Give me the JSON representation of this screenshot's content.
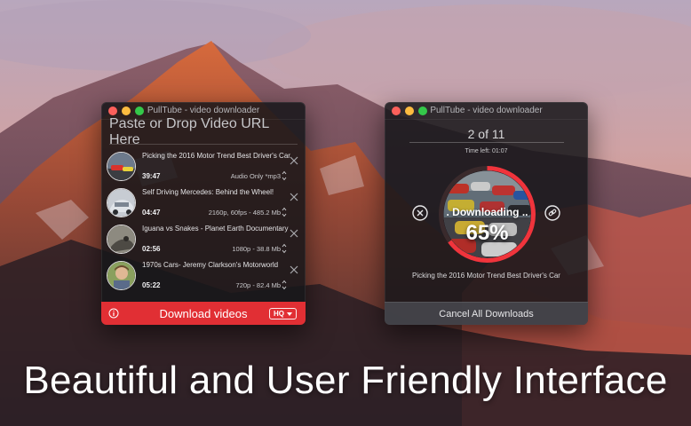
{
  "left_window": {
    "title": "PullTube - video downloader",
    "url_placeholder": "Paste or Drop Video URL Here",
    "items": [
      {
        "title": "Picking the 2016 Motor Trend Best Driver's Car",
        "duration": "39:47",
        "format": "Audio Only *mp3"
      },
      {
        "title": "Self Driving Mercedes: Behind the Wheel!",
        "duration": "04:47",
        "format": "2160p, 60fps - 485.2 Mb"
      },
      {
        "title": "Iguana vs Snakes - Planet Earth Documentary",
        "duration": "02:56",
        "format": "1080p - 38.8 Mb"
      },
      {
        "title": "1970s Cars- Jeremy Clarkson's Motorworld",
        "duration": "05:22",
        "format": "720p - 82.4 Mb"
      }
    ],
    "download_label": "Download videos",
    "quality_label": "HQ"
  },
  "right_window": {
    "title": "PullTube - video downloader",
    "counter": "2 of 11",
    "time_left": "Time left:  01:07",
    "status": ". Downloading ..",
    "progress_text": "65%",
    "progress": 0.65,
    "current_title": "Picking the 2016 Motor Trend Best Driver's Car",
    "cancel_label": "Cancel All Downloads"
  },
  "tagline": "Beautiful and User Friendly Interface",
  "colors": {
    "accent_red": "#e12f34",
    "ring_red": "#f0343c"
  },
  "icons": [
    "close-icon",
    "info-icon",
    "chevron-down-icon",
    "up-down-icon",
    "link-icon",
    "cancel-circle-icon"
  ]
}
